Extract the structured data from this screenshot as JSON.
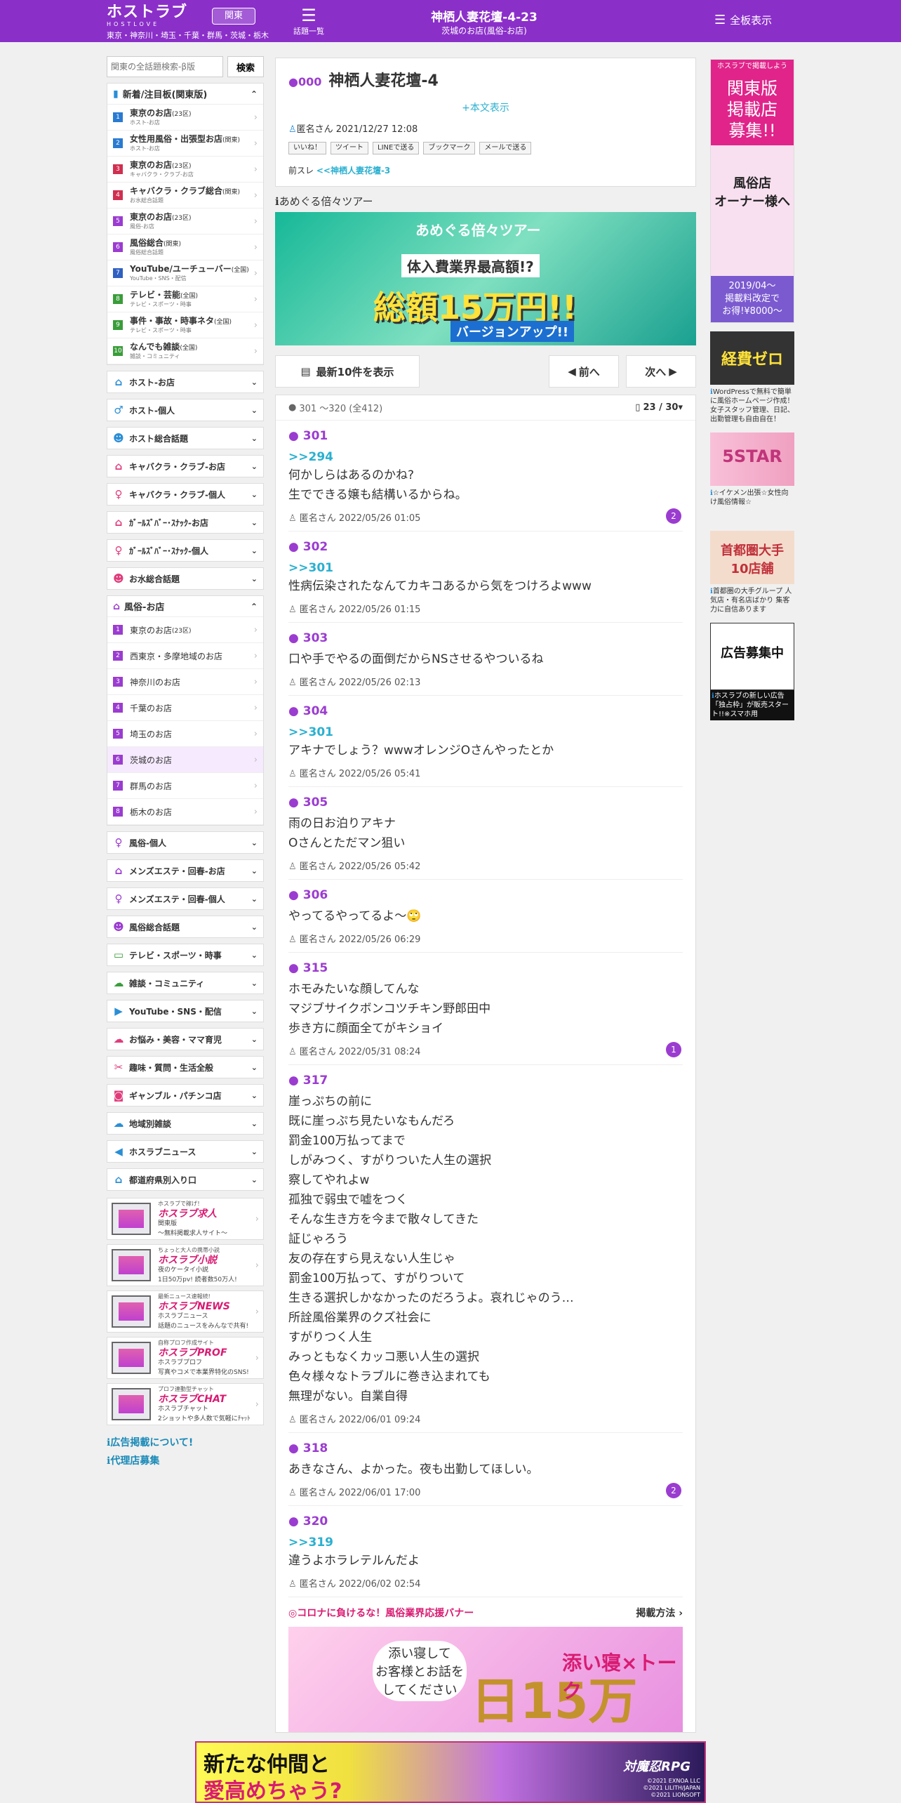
{
  "header": {
    "logo": "ホストラブ",
    "logo_sub": "HOSTLOVE",
    "region_button": "関東",
    "region_list": "東京・神奈川・埼玉・千葉・群馬・茨城・栃木",
    "topics_label": "話題一覧",
    "title": "神栖人妻花壇-4-23",
    "subtitle": "茨城のお店(風俗-お店)",
    "all_boards": "全板表示"
  },
  "search": {
    "placeholder": "関東の全話題検索-β版",
    "button": "検索"
  },
  "new_boards": {
    "title": "新着/注目板(関東版)",
    "items": [
      {
        "num": "1",
        "color": "#2a7bd0",
        "name": "東京のお店",
        "tag": "(23区)",
        "desc": "ホスト-お店"
      },
      {
        "num": "2",
        "color": "#2a7bd0",
        "name": "女性用風俗・出張型お店",
        "tag": "(関東)",
        "desc": "ホスト-お店"
      },
      {
        "num": "3",
        "color": "#d03050",
        "name": "東京のお店",
        "tag": "(23区)",
        "desc": "キャバクラ・クラブ-お店"
      },
      {
        "num": "4",
        "color": "#d03050",
        "name": "キャバクラ・クラブ総合",
        "tag": "(関東)",
        "desc": "お水総合話題"
      },
      {
        "num": "5",
        "color": "#9b3cd0",
        "name": "東京のお店",
        "tag": "(23区)",
        "desc": "風俗-お店"
      },
      {
        "num": "6",
        "color": "#9b3cd0",
        "name": "風俗総合",
        "tag": "(関東)",
        "desc": "風俗総合話題"
      },
      {
        "num": "7",
        "color": "#3060c0",
        "name": "YouTube/ユーチューバー",
        "tag": "(全国)",
        "desc": "YouTube・SNS・配信"
      },
      {
        "num": "8",
        "color": "#3a9d3a",
        "name": "テレビ・芸能",
        "tag": "(全国)",
        "desc": "テレビ・スポーツ・時事"
      },
      {
        "num": "9",
        "color": "#3a9d3a",
        "name": "事件・事故・時事ネタ",
        "tag": "(全国)",
        "desc": "テレビ・スポーツ・時事"
      },
      {
        "num": "10",
        "color": "#3a9d3a",
        "name": "なんでも雑談",
        "tag": "(全国)",
        "desc": "雑談・コミュニティ"
      }
    ]
  },
  "sections_top": [
    {
      "name": "ホスト-お店",
      "icon": "⌂",
      "cls": "",
      "chev": "⌄"
    },
    {
      "name": "ホスト-個人",
      "icon": "♂",
      "cls": "",
      "chev": "⌄"
    },
    {
      "name": "ホスト総合話題",
      "icon": "☻",
      "cls": "",
      "chev": "⌄"
    },
    {
      "name": "キャバクラ・クラブ-お店",
      "icon": "⌂",
      "cls": "pink",
      "chev": "⌄"
    },
    {
      "name": "キャバクラ・クラブ-個人",
      "icon": "♀",
      "cls": "pink",
      "chev": "⌄"
    },
    {
      "name": "ｶﾞｰﾙｽﾞﾊﾞｰ･ｽﾅｯｸ-お店",
      "icon": "⌂",
      "cls": "pink",
      "chev": "⌄"
    },
    {
      "name": "ｶﾞｰﾙｽﾞﾊﾞｰ･ｽﾅｯｸ-個人",
      "icon": "♀",
      "cls": "pink",
      "chev": "⌄"
    },
    {
      "name": "お水総合話題",
      "icon": "☻",
      "cls": "pink",
      "chev": "⌄"
    }
  ],
  "fuzoku": {
    "title": "風俗-お店",
    "chev": "⌃",
    "items": [
      {
        "num": "1",
        "name": "東京のお店",
        "tag": "(23区)"
      },
      {
        "num": "2",
        "name": "西東京・多摩地域のお店",
        "tag": ""
      },
      {
        "num": "3",
        "name": "神奈川のお店",
        "tag": ""
      },
      {
        "num": "4",
        "name": "千葉のお店",
        "tag": ""
      },
      {
        "num": "5",
        "name": "埼玉のお店",
        "tag": ""
      },
      {
        "num": "6",
        "name": "茨城のお店",
        "tag": ""
      },
      {
        "num": "7",
        "name": "群馬のお店",
        "tag": ""
      },
      {
        "num": "8",
        "name": "栃木のお店",
        "tag": ""
      }
    ]
  },
  "sections_bottom": [
    {
      "name": "風俗-個人",
      "icon": "♀",
      "cls": "purple",
      "chev": "⌄"
    },
    {
      "name": "メンズエステ・回春-お店",
      "icon": "⌂",
      "cls": "purple",
      "chev": "⌄"
    },
    {
      "name": "メンズエステ・回春-個人",
      "icon": "♀",
      "cls": "purple",
      "chev": "⌄"
    },
    {
      "name": "風俗総合話題",
      "icon": "☻",
      "cls": "purple",
      "chev": "⌄"
    },
    {
      "name": "テレビ・スポーツ・時事",
      "icon": "▭",
      "cls": "green",
      "chev": "⌄"
    },
    {
      "name": "雑談・コミュニティ",
      "icon": "☁",
      "cls": "green",
      "chev": "⌄"
    },
    {
      "name": "YouTube・SNS・配信",
      "icon": "▶",
      "cls": "",
      "chev": "⌄"
    },
    {
      "name": "お悩み・美容・ママ育児",
      "icon": "☁",
      "cls": "pink",
      "chev": "⌄"
    },
    {
      "name": "趣味・質問・生活全般",
      "icon": "✂",
      "cls": "pink",
      "chev": "⌄"
    },
    {
      "name": "ギャンブル・パチンコ店",
      "icon": "◙",
      "cls": "pink",
      "chev": "⌄"
    },
    {
      "name": "地域別雑談",
      "icon": "☁",
      "cls": "",
      "chev": "⌄"
    },
    {
      "name": "ホスラブニュース",
      "icon": "◀",
      "cls": "",
      "chev": "⌄"
    },
    {
      "name": "都道府県別入り口",
      "icon": "⌂",
      "cls": "",
      "chev": "⌄"
    }
  ],
  "promos": [
    {
      "tag": "ホスラブで稼げ！",
      "logo": "ホスラブ求人",
      "desc": "関東版\n〜無料掲載求人サイト〜"
    },
    {
      "tag": "ちょっと大人の携帯小説",
      "logo": "ホスラブ小説",
      "desc": "夜のケータイ小説\n1日50万pv! 読者数50万人!"
    },
    {
      "tag": "最新ニュース速報続!",
      "logo": "ホスラブNEWS",
      "desc": "ホスラブニュース\n話題のニュースをみんなで共有!"
    },
    {
      "tag": "自称プロフ作成サイト",
      "logo": "ホスラブPROF",
      "desc": "ホスラブプロフ\n写真やコメで本業界特化のSNS!"
    },
    {
      "tag": "プロフ連動型チャット",
      "logo": "ホスラブCHAT",
      "desc": "ホスラブチャット\n2ショットや多人数で気軽にﾁｬｯﾄ"
    }
  ],
  "side_links": [
    "広告掲載について!",
    "代理店募集"
  ],
  "thread": {
    "num": "000",
    "title": "神栖人妻花壇-4",
    "show_body": "+本文表示",
    "poster": "匿名さん 2021/12/27 12:08",
    "share": [
      "いいね！",
      "ツイート",
      "LINEで送る",
      "ブックマーク",
      "メールで送る"
    ],
    "prev_label": "前スレ",
    "prev_link": "<<神栖人妻花壇-3"
  },
  "tour": {
    "label": "あめぐる倍々ツアー",
    "banner_title": "あめぐる倍々ツアー",
    "banner_sub": "体入費業界最高額!?",
    "banner_main": "総額15万円!!",
    "banner_foot": "バージョンアップ!!"
  },
  "nav": {
    "latest": "最新10件を表示",
    "prev": "前へ",
    "next": "次へ"
  },
  "posts_head": {
    "range": "301 〜320 (全412)",
    "page": "23 / 30"
  },
  "posts": [
    {
      "num": "301",
      "reply": ">>294",
      "body": "何かしらはあるのかね?\n生でできる嬢も結構いるからね。",
      "meta": "匿名さん 2022/05/26 01:05",
      "badge": "2"
    },
    {
      "num": "302",
      "reply": ">>301",
      "body": "性病伝染されたなんてカキコあるから気をつけろよwww",
      "meta": "匿名さん 2022/05/26 01:15",
      "badge": ""
    },
    {
      "num": "303",
      "reply": "",
      "body": "口や手でやるの面倒だからNSさせるやついるね",
      "meta": "匿名さん 2022/05/26 02:13",
      "badge": ""
    },
    {
      "num": "304",
      "reply": ">>301",
      "body": "アキナでしょう？wwwオレンジOさんやったとか",
      "meta": "匿名さん 2022/05/26 05:41",
      "badge": ""
    },
    {
      "num": "305",
      "reply": "",
      "body": "雨の日お泊りアキナ\nOさんとただマン狙い",
      "meta": "匿名さん 2022/05/26 05:42",
      "badge": ""
    },
    {
      "num": "306",
      "reply": "",
      "body": "やってるやってるよ～🙄",
      "meta": "匿名さん 2022/05/26 06:29",
      "badge": ""
    },
    {
      "num": "315",
      "reply": "",
      "body": "ホモみたいな顔してんな\nマジブサイクボンコツチキン野郎田中\n歩き方に顔面全てがキショイ",
      "meta": "匿名さん 2022/05/31 08:24",
      "badge": "1"
    },
    {
      "num": "317",
      "reply": "",
      "body": "崖っぷちの前に\n既に崖っぷち見たいなもんだろ\n罰金100万払ってまで\nしがみつく、すがりついた人生の選択\n察してやれよw\n孤独で弱虫で嘘をつく\nそんな生き方を今まで散々してきた\n証じゃろう\n友の存在すら見えない人生じゃ\n罰金100万払って、すがりついて\n生きる選択しかなかったのだろうよ。哀れじゃのう…\n所詮風俗業界のクズ社会に\nすがりつく人生\nみっともなくカッコ悪い人生の選択\n色々様々なトラブルに巻き込まれても\n無理がない。自業自得",
      "meta": "匿名さん 2022/06/01 09:24",
      "badge": ""
    },
    {
      "num": "318",
      "reply": "",
      "body": "あきなさん、よかった。夜も出勤してほしい。",
      "meta": "匿名さん 2022/06/01 17:00",
      "badge": "2"
    },
    {
      "num": "320",
      "reply": ">>319",
      "body": "違うよホラレテルんだよ",
      "meta": "匿名さん 2022/06/02 02:54",
      "badge": ""
    }
  ],
  "corona": {
    "label": "◎コロナに負けるな！風俗業界応援バナー",
    "method": "掲載方法",
    "banner_a": "添い寝して\nお客様とお話を\nしてください",
    "banner_b": "日15万",
    "banner_c": "添い寝×トーク"
  },
  "right_ads": {
    "tall_top": "ホスラブで掲載しよう",
    "tall_main": "関東版\n掲載店\n募集!!",
    "tall_mid": "風俗店\nオーナー様へ",
    "tall_bottom": "2019/04〜\n掲載料改定で\nお得!¥8000〜",
    "ad2_text": "経費ゼロ",
    "ad2_cap": "WordPressで無料で簡単に風俗ホームページ作成！女子スタッフ管理、日記、出勤管理も自由自在！",
    "ad3_text": "5STAR",
    "ad3_cap": "☆イケメン出張☆女性向け風俗情報☆",
    "ad4_text": "首都圏大手\n10店舗",
    "ad4_cap": "首都圏の大手グループ 人気店・有名店ばかり 集客力に自信あります",
    "ad5_text": "広告募集中",
    "ad5_cap": "ホスラブの新しい広告「独占枠」が販売スタート!!※スマホ用"
  },
  "bottom_ad": {
    "line1": "新たな仲間と",
    "line2": "愛高めちゃう?",
    "brand": "対魔忍RPG",
    "copyright": "©2021 EXNOA LLC\n©2021 LILITH/JAPAN\n©2021 LIONSOFT"
  }
}
